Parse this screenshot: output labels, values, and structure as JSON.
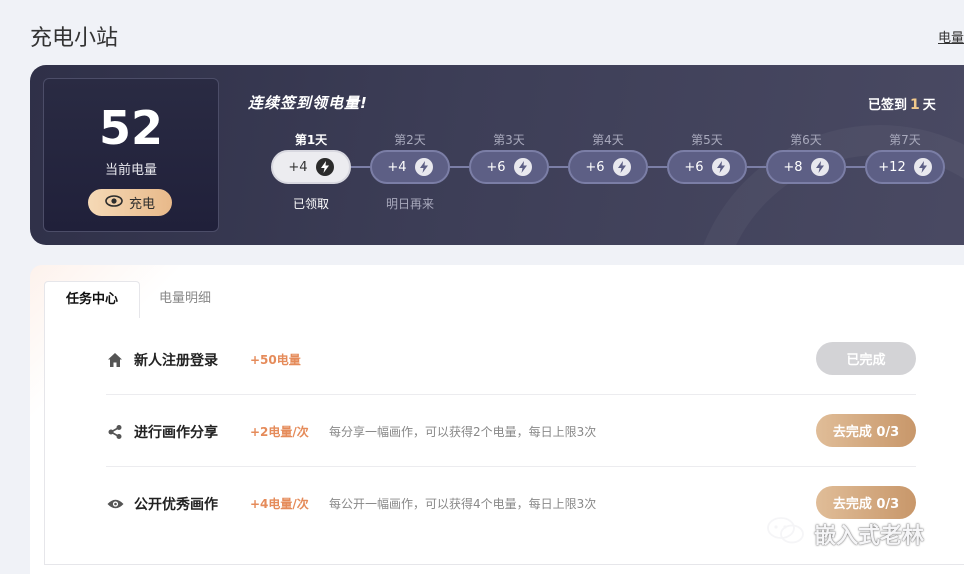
{
  "page": {
    "title": "充电小站",
    "top_link": "电量"
  },
  "energy": {
    "value": "52",
    "label": "当前电量",
    "charge_button": "充电"
  },
  "signin": {
    "title": "连续签到领电量!",
    "signed_prefix": "已签到",
    "signed_count": "1",
    "signed_suffix": "天",
    "days": [
      {
        "label": "第1天",
        "reward": "+4",
        "status": "已领取",
        "state": "claimed"
      },
      {
        "label": "第2天",
        "reward": "+4",
        "status": "明日再来",
        "state": "next"
      },
      {
        "label": "第3天",
        "reward": "+6",
        "status": "",
        "state": "pending"
      },
      {
        "label": "第4天",
        "reward": "+6",
        "status": "",
        "state": "pending"
      },
      {
        "label": "第5天",
        "reward": "+6",
        "status": "",
        "state": "pending"
      },
      {
        "label": "第6天",
        "reward": "+8",
        "status": "",
        "state": "pending"
      },
      {
        "label": "第7天",
        "reward": "+12",
        "status": "",
        "state": "pending"
      }
    ]
  },
  "tabs": [
    {
      "label": "任务中心",
      "active": true
    },
    {
      "label": "电量明细",
      "active": false
    }
  ],
  "tasks": [
    {
      "icon": "home-icon",
      "name": "新人注册登录",
      "reward": "+50电量",
      "desc": "",
      "button": "已完成",
      "state": "done"
    },
    {
      "icon": "share-icon",
      "name": "进行画作分享",
      "reward": "+2电量/次",
      "desc": "每分享一幅画作，可以获得2个电量，每日上限3次",
      "button": "去完成 0/3",
      "state": "go"
    },
    {
      "icon": "eye-icon",
      "name": "公开优秀画作",
      "reward": "+4电量/次",
      "desc": "每公开一幅画作，可以获得4个电量，每日上限3次",
      "button": "去完成 0/3",
      "state": "go"
    }
  ],
  "watermark": {
    "text": "嵌入式老林"
  },
  "colors": {
    "banner": "#3d3e57",
    "accent": "#e58b5a",
    "gold": "#f2c98b",
    "button_go": "#c8976a"
  }
}
